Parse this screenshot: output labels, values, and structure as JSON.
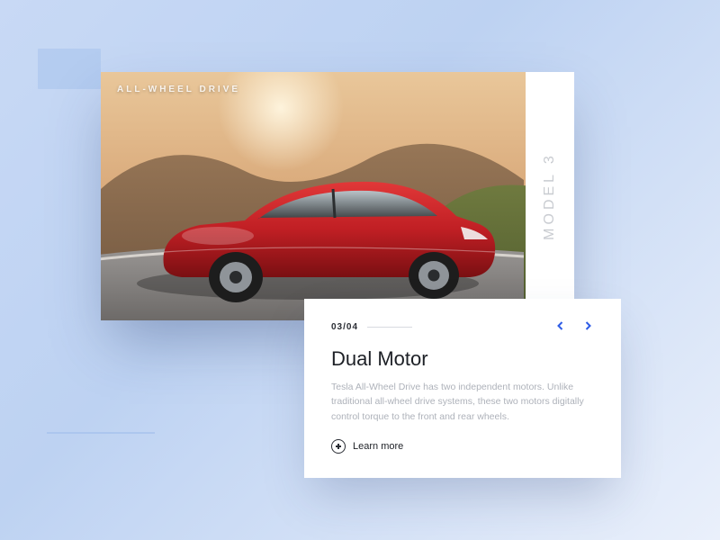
{
  "hero": {
    "overlay_label": "ALL-WHEEL DRIVE",
    "sidebar_label": "MODEL 3"
  },
  "card": {
    "counter": "03/04",
    "title": "Dual Motor",
    "description": "Tesla All-Wheel Drive has two independent motors. Unlike traditional all-wheel drive systems, these two motors digitally control torque to the front and rear wheels.",
    "learn_more_label": "Learn more"
  },
  "colors": {
    "accent": "#2e5ce6"
  }
}
